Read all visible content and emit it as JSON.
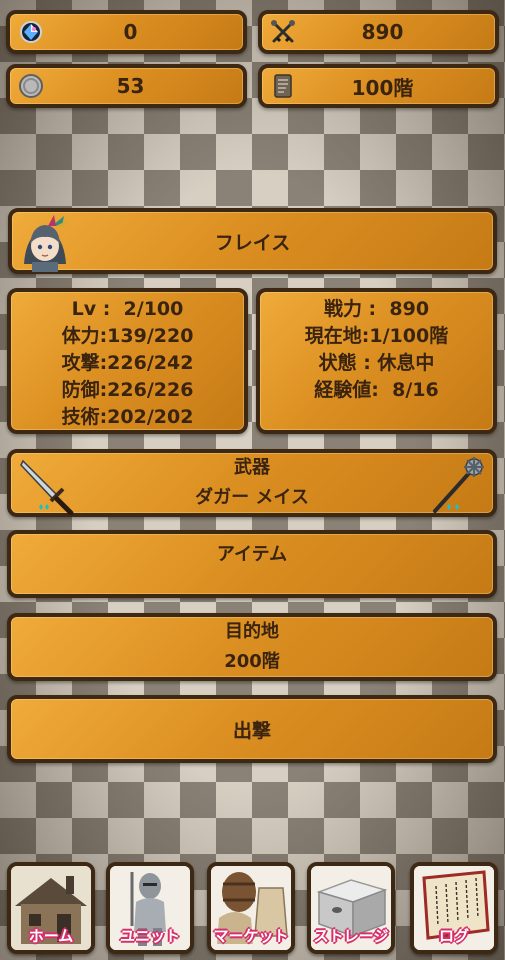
{
  "resources": {
    "gems": {
      "icon": "gem-icon",
      "value": "0"
    },
    "power": {
      "icon": "crossed-swords-icon",
      "value": "890"
    },
    "coins": {
      "icon": "silver-coin-icon",
      "value": "53"
    },
    "floor": {
      "icon": "scroll-icon",
      "value": "100階"
    }
  },
  "character": {
    "name": "フレイス",
    "portrait": "character-portrait"
  },
  "stats_left": [
    "Lv :  2/100",
    "体力:139/220",
    "攻撃:226/242",
    "防御:226/226",
    "技術:202/202"
  ],
  "stats_right": [
    "戦力 :  890",
    "現在地:1/100階",
    "状態 : 休息中",
    "経験値:  8/16"
  ],
  "weapon": {
    "title": "武器",
    "names": "ダガー メイス",
    "left_icon": "dagger-icon",
    "right_icon": "mace-icon"
  },
  "item": {
    "title": "アイテム"
  },
  "destination": {
    "title": "目的地",
    "value": "200階"
  },
  "sortie": {
    "label": "出撃"
  },
  "nav": [
    {
      "label": "ホーム",
      "icon": "house-icon"
    },
    {
      "label": "ユニット",
      "icon": "knight-icon"
    },
    {
      "label": "マーケット",
      "icon": "market-icon"
    },
    {
      "label": "ストレージ",
      "icon": "chest-icon"
    },
    {
      "label": "ログ",
      "icon": "log-scroll-icon"
    }
  ],
  "colors": {
    "panel": "#dc9022",
    "border": "#3d2814",
    "nav_text_outline": "#d6306b"
  }
}
